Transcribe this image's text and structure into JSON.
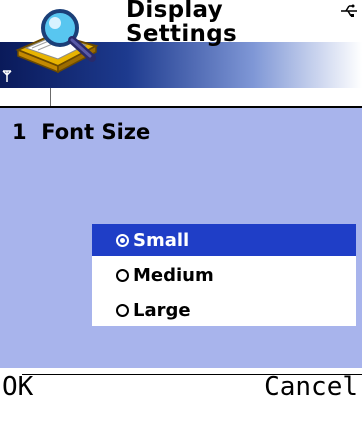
{
  "header": {
    "title_line1": "Display",
    "title_line2": "Settings",
    "app_icon": "magnifier-over-book-icon",
    "connectivity_icon": "usb-connection-icon",
    "signal_icon": "signal-antenna-icon"
  },
  "setting": {
    "index": "1",
    "label": "Font Size"
  },
  "options": [
    {
      "label": "Small",
      "selected": true
    },
    {
      "label": "Medium",
      "selected": false
    },
    {
      "label": "Large",
      "selected": false
    }
  ],
  "softkeys": {
    "left": "OK",
    "right": "Cancel"
  },
  "colors": {
    "panel": "#a8b4ec",
    "selection": "#1f3ec7",
    "header_band_dark": "#0a1a5a"
  }
}
